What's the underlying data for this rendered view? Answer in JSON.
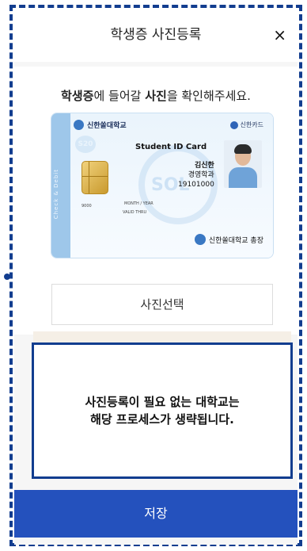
{
  "header": {
    "title": "학생증 사진등록",
    "close_icon": "×"
  },
  "prompt": {
    "part1": "학생증",
    "part2": "에 들어갈 ",
    "part3": "사진",
    "part4": "을 확인해주세요."
  },
  "card": {
    "university_logo": "신한쏠대학교",
    "card_brand": "신한카드",
    "badge": "S20",
    "title": "Student ID Card",
    "name": "김신한",
    "department": "경영학과",
    "student_no": "19101000",
    "strip_text": "Check & Debit",
    "small_left": "9000",
    "small_mid": "MONTH / YEAR",
    "small_valid": "VALID THRU",
    "watermark": "SOL",
    "issuer": "신한쏠대학교 총장"
  },
  "select_button": "사진선택",
  "notice": {
    "line1": "사진등록이 필요 없는 대학교는",
    "line2": "해당 프로세스가 생략됩니다."
  },
  "save_button": "저장",
  "colors": {
    "primary": "#2451bd",
    "frame": "#123d8f"
  }
}
